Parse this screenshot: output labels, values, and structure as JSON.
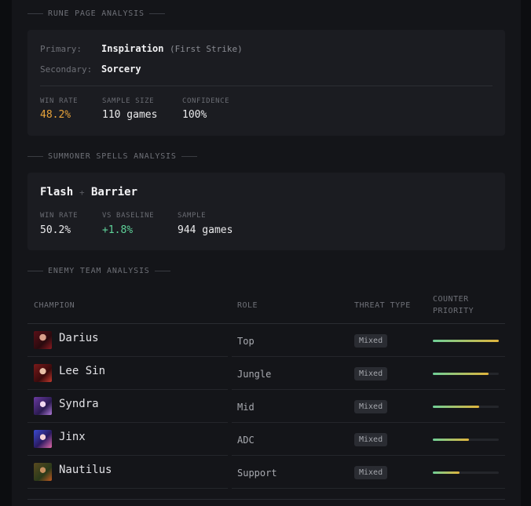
{
  "rune": {
    "section_title": "RUNE PAGE ANALYSIS",
    "primary_label": "Primary:",
    "primary_value": "Inspiration",
    "primary_keystone": "(First Strike)",
    "secondary_label": "Secondary:",
    "secondary_value": "Sorcery",
    "winrate_label": "WIN RATE",
    "winrate_value": "48.2%",
    "sample_label": "SAMPLE SIZE",
    "sample_value": "110 games",
    "confidence_label": "CONFIDENCE",
    "confidence_value": "100%",
    "winrate_color": "#e8a33a"
  },
  "spells": {
    "section_title": "SUMMONER SPELLS ANALYSIS",
    "spell1": "Flash",
    "plus": "+",
    "spell2": "Barrier",
    "winrate_label": "WIN RATE",
    "winrate_value": "50.2%",
    "baseline_label": "VS BASELINE",
    "baseline_value": "+1.8%",
    "sample_label": "SAMPLE",
    "sample_value": "944 games",
    "baseline_color": "#5fd39a"
  },
  "enemy": {
    "section_title": "ENEMY TEAM ANALYSIS",
    "col_champion": "CHAMPION",
    "col_role": "ROLE",
    "col_threat": "THREAT TYPE",
    "col_priority_1": "COUNTER",
    "col_priority_2": "PRIORITY",
    "rows": [
      {
        "champion": "Darius",
        "role": "Top",
        "threat": "Mixed",
        "priority": 1.0,
        "icon": "darius-portrait-icon"
      },
      {
        "champion": "Lee Sin",
        "role": "Jungle",
        "threat": "Mixed",
        "priority": 0.85,
        "icon": "lee-sin-portrait-icon"
      },
      {
        "champion": "Syndra",
        "role": "Mid",
        "threat": "Mixed",
        "priority": 0.7,
        "icon": "syndra-portrait-icon"
      },
      {
        "champion": "Jinx",
        "role": "ADC",
        "threat": "Mixed",
        "priority": 0.55,
        "icon": "jinx-portrait-icon"
      },
      {
        "champion": "Nautilus",
        "role": "Support",
        "threat": "Mixed",
        "priority": 0.4,
        "icon": "nautilus-portrait-icon"
      }
    ]
  }
}
